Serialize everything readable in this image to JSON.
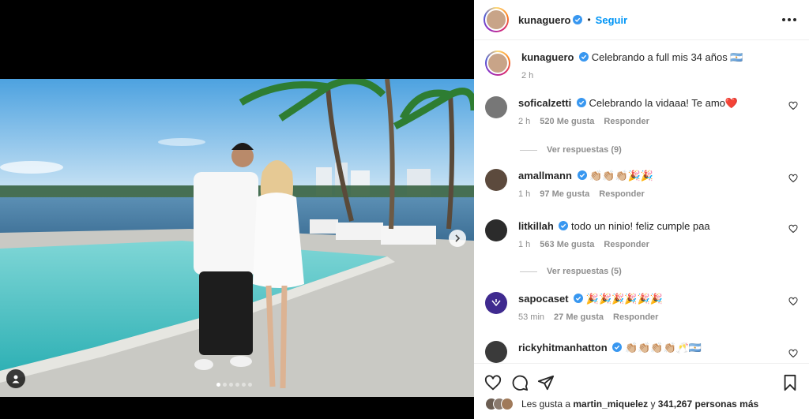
{
  "post": {
    "author": "kunaguero",
    "follow_label": "Seguir",
    "separator": "•",
    "caption": "Celebrando a full mis 34 años 🇦🇷",
    "caption_time": "2 h",
    "carousel": {
      "slide_count": 6,
      "active_index": 0
    }
  },
  "comments": [
    {
      "user": "soficalzetti",
      "verified": true,
      "text": "Celebrando la vidaaa! Te amo❤️",
      "time": "2 h",
      "likes": "520 Me gusta",
      "reply_label": "Responder",
      "replies": "Ver respuestas (9)"
    },
    {
      "user": "amallmann",
      "verified": true,
      "text": "👏🏼👏🏼👏🏼🎉🎉",
      "time": "1 h",
      "likes": "97 Me gusta",
      "reply_label": "Responder"
    },
    {
      "user": "litkillah",
      "verified": true,
      "text": "todo un ninio! feliz cumple paa",
      "time": "1 h",
      "likes": "563 Me gusta",
      "reply_label": "Responder",
      "replies": "Ver respuestas (5)"
    },
    {
      "user": "sapocaset",
      "verified": true,
      "text": "🎉🎉🎉🎉🎉🎉",
      "time": "53 min",
      "likes": "27 Me gusta",
      "reply_label": "Responder"
    },
    {
      "user": "rickyhitmanhatton",
      "verified": true,
      "text": "👏🏼👏🏼👏🏼👏🏼🥂🇦🇷"
    }
  ],
  "likes_summary": {
    "prefix": "Les gusta a",
    "user": "martin_miquelez",
    "middle": "y",
    "count": "341,267 personas más"
  },
  "colors": {
    "follow": "#0095f6",
    "verified": "#3897f0",
    "muted": "#8e8e8e"
  },
  "icons": [
    "heart-icon",
    "comment-icon",
    "share-icon",
    "bookmark-icon",
    "more-icon",
    "chevron-right-icon",
    "user-tag-icon"
  ]
}
